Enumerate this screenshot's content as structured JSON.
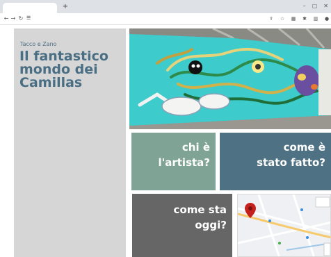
{
  "browser": {
    "new_tab_icon": "plus-icon",
    "controls": {
      "minimize": "–",
      "maximize": "▢",
      "close": "✕"
    },
    "nav": {
      "back": "←",
      "forward": "→",
      "reload": "↻"
    },
    "site_icon": "tune-icon",
    "toolbar_icons": [
      "share-icon",
      "star-icon",
      "extension-icon",
      "puzzle-icon",
      "sidebar-icon",
      "profile-icon"
    ]
  },
  "sidebar": {
    "author": "Tacco e Zano",
    "title": "Il fantastico mondo dei Camillas"
  },
  "tiles": {
    "artist": {
      "line1": "chi è",
      "line2": "l'artista?"
    },
    "made": {
      "line1": "come è",
      "line2": "stato fatto?"
    },
    "today": {
      "line1": "come sta",
      "line2": "oggi?"
    }
  },
  "colors": {
    "title": "#4a6f85",
    "tile_artist": "#7fa394",
    "tile_made": "#4f7184",
    "tile_today": "#666666"
  }
}
